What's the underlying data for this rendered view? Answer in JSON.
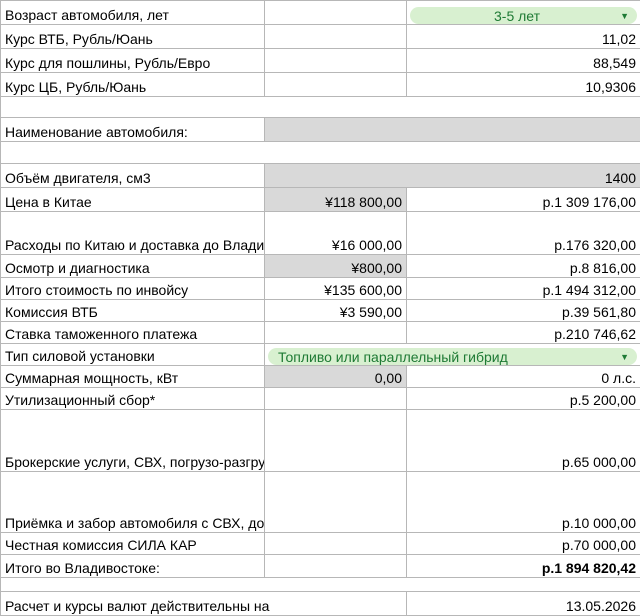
{
  "rows": {
    "age": {
      "label": "Возраст автомобиля, лет",
      "value": "3-5 лет"
    },
    "vtb_rate": {
      "label": "Курс ВТБ, Рубль/Юань",
      "value": "11,02"
    },
    "duty_rate": {
      "label": "Курс для пошлины, Рубль/Евро",
      "value": "88,549"
    },
    "cb_rate": {
      "label": "Курс ЦБ, Рубль/Юань",
      "value": "10,9306"
    },
    "car_name": {
      "label": "Наименование автомобиля:"
    },
    "engine": {
      "label": "Объём двигателя, см3",
      "value": "1400"
    },
    "price_china": {
      "label": "Цена в Китае",
      "cny": "¥118 800,00",
      "rub": "р.1 309 176,00"
    },
    "china_costs": {
      "label": "Расходы по Китаю и доставка до Владивостока",
      "cny": "¥16 000,00",
      "rub": "р.176 320,00"
    },
    "inspection": {
      "label": "Осмотр и диагностика",
      "cny": "¥800,00",
      "rub": "р.8 816,00"
    },
    "invoice_total": {
      "label": "Итого стоимость по инвойсу",
      "cny": "¥135 600,00",
      "rub": "р.1 494 312,00"
    },
    "vtb_fee": {
      "label": "Комиссия ВТБ",
      "cny": "¥3 590,00",
      "rub": "р.39 561,80"
    },
    "customs": {
      "label": "Ставка таможенного платежа",
      "rub": "р.210 746,62"
    },
    "powertrain": {
      "label": "Тип силовой установки",
      "value": "Топливо или параллельный гибрид"
    },
    "power": {
      "label": "Суммарная мощность, кВт",
      "kw": "0,00",
      "hp": "0 л.с."
    },
    "util_fee": {
      "label": "Утилизационный сбор*",
      "rub": "р.5 200,00"
    },
    "broker": {
      "label": "Брокерские услуги, СВХ, погрузо-разгрузочные работы, прохождение лаборатории и прочее",
      "rub": "р.65 000,00"
    },
    "pickup": {
      "label": "Приёмка и забор автомобиля с СВХ, доставка до лаборатории, доставка до стоянки",
      "rub": "р.10 000,00"
    },
    "sila_fee": {
      "label": "Честная комиссия СИЛА КАР",
      "rub": "р.70 000,00"
    },
    "total": {
      "label": "Итого во Владивостоке:",
      "rub": "р.1 894 820,42"
    },
    "valid": {
      "label": "Расчет и курсы валют действительны на",
      "date": "13.05.2026"
    }
  },
  "colors": {
    "chip_bg": "#d8f0d0",
    "chip_text": "#1e7a34",
    "gray_cell": "#d9d9d9",
    "grid": "#b7b7b7"
  }
}
